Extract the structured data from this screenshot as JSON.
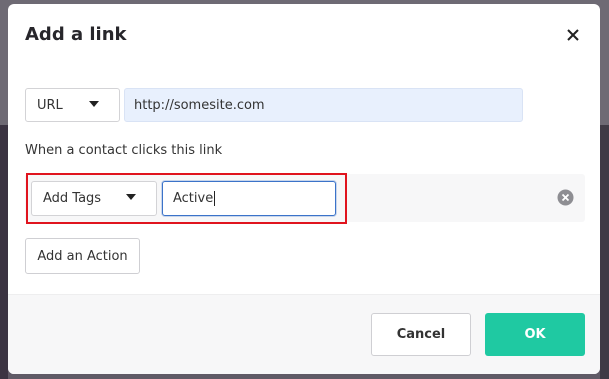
{
  "modal": {
    "title": "Add a link",
    "close_icon": "close-icon"
  },
  "link": {
    "type_selected": "URL",
    "url_value": "http://somesite.com"
  },
  "actions": {
    "section_label": "When a contact clicks this link",
    "action_type_selected": "Add Tags",
    "tags_value": "Active",
    "remove_icon": "remove-circle-icon",
    "add_action_label": "Add an Action"
  },
  "footer": {
    "cancel_label": "Cancel",
    "ok_label": "OK"
  },
  "colors": {
    "ok_button": "#1fc9a2",
    "highlight_border": "#e0141e",
    "focused_input_border": "#3b73c9",
    "url_input_bg": "#e8f0fd"
  }
}
